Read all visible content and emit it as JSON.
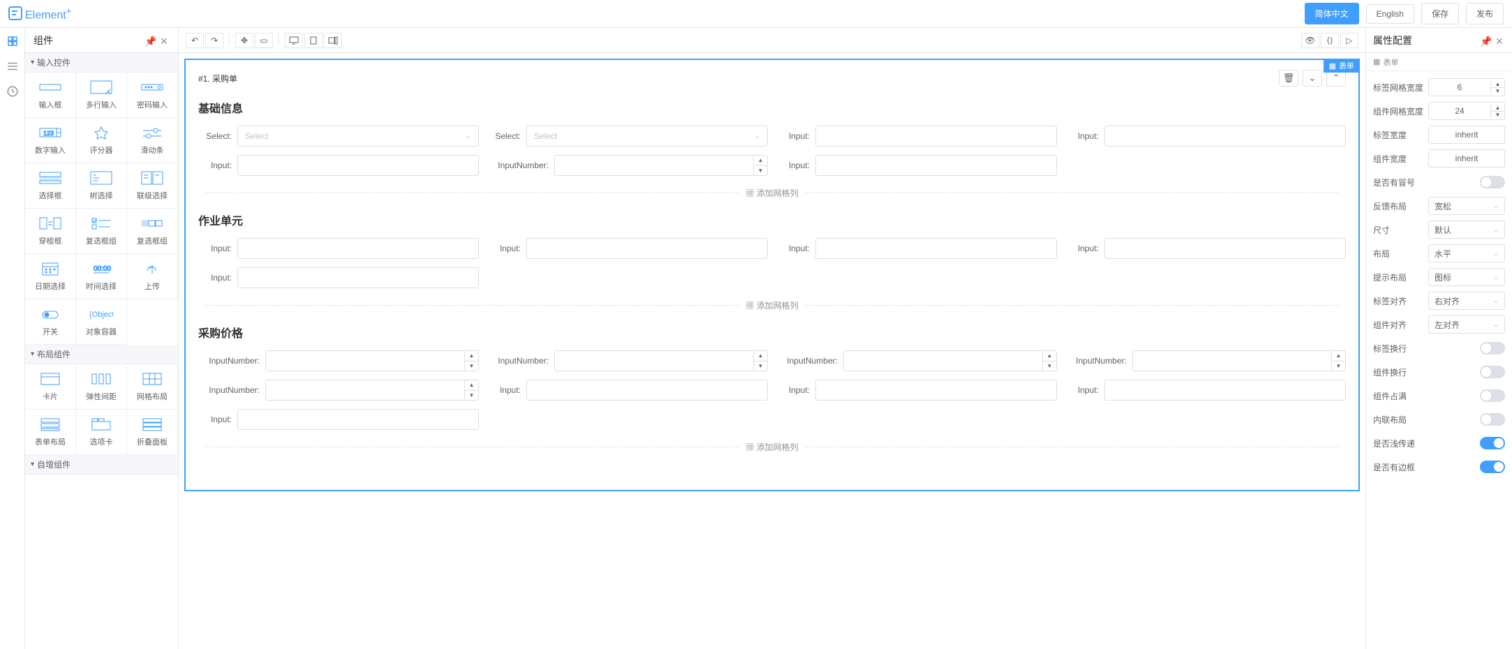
{
  "logo": {
    "text": "Element",
    "sup": "+"
  },
  "topbar": {
    "langZh": "简体中文",
    "langEn": "English",
    "save": "保存",
    "publish": "发布"
  },
  "sidebar": {
    "title": "组件",
    "groups": {
      "input": {
        "label": "输入控件",
        "items": [
          {
            "label": "输入框",
            "icon": "input"
          },
          {
            "label": "多行输入",
            "icon": "textarea"
          },
          {
            "label": "密码输入",
            "icon": "password"
          },
          {
            "label": "数字输入",
            "icon": "number"
          },
          {
            "label": "评分器",
            "icon": "rate"
          },
          {
            "label": "滑动条",
            "icon": "slider"
          },
          {
            "label": "选择框",
            "icon": "select"
          },
          {
            "label": "树选择",
            "icon": "treeselect"
          },
          {
            "label": "联级选择",
            "icon": "cascader"
          },
          {
            "label": "穿梭框",
            "icon": "transfer"
          },
          {
            "label": "复选框组",
            "icon": "checkbox"
          },
          {
            "label": "复选框组",
            "icon": "checkboxbtn"
          },
          {
            "label": "日期选择",
            "icon": "date"
          },
          {
            "label": "时间选择",
            "icon": "time"
          },
          {
            "label": "上传",
            "icon": "upload"
          },
          {
            "label": "开关",
            "icon": "switch"
          },
          {
            "label": "对象容器",
            "icon": "object"
          }
        ]
      },
      "layout": {
        "label": "布局组件",
        "items": [
          {
            "label": "卡片",
            "icon": "card"
          },
          {
            "label": "弹性间距",
            "icon": "space"
          },
          {
            "label": "网格布局",
            "icon": "grid"
          },
          {
            "label": "表单布局",
            "icon": "formlayout"
          },
          {
            "label": "选项卡",
            "icon": "tabs"
          },
          {
            "label": "折叠面板",
            "icon": "collapse"
          }
        ]
      },
      "self": {
        "label": "自增组件"
      }
    }
  },
  "canvas": {
    "formTag": "表单",
    "formTitle": "#1. 采购单",
    "section1": "基础信息",
    "section2": "作业单元",
    "section3": "采购价格",
    "labels": {
      "select": "Select:",
      "input": "Input:",
      "inputNumber": "InputNumber:"
    },
    "placeholder": {
      "select": "Select"
    },
    "addHint": "添加网格列"
  },
  "props": {
    "title": "属性配置",
    "subtitle": "表单",
    "fields": {
      "labelGridWidth": {
        "label": "标签网格宽度",
        "value": "6"
      },
      "compGridWidth": {
        "label": "组件网格宽度",
        "value": "24"
      },
      "labelWidth": {
        "label": "标签宽度",
        "value": "inherit"
      },
      "compWidth": {
        "label": "组件宽度",
        "value": "inherit"
      },
      "hasColon": {
        "label": "是否有冒号"
      },
      "feedbackLayout": {
        "label": "反馈布局",
        "value": "宽松"
      },
      "size": {
        "label": "尺寸",
        "value": "默认"
      },
      "layout": {
        "label": "布局",
        "value": "水平"
      },
      "tooltipLayout": {
        "label": "提示布局",
        "value": "图标"
      },
      "labelAlign": {
        "label": "标签对齐",
        "value": "右对齐"
      },
      "compAlign": {
        "label": "组件对齐",
        "value": "左对齐"
      },
      "labelWrap": {
        "label": "标签换行"
      },
      "compWrap": {
        "label": "组件换行"
      },
      "fill": {
        "label": "组件占满"
      },
      "inline": {
        "label": "内联布局"
      },
      "shallow": {
        "label": "是否浅传递"
      },
      "border": {
        "label": "是否有边框"
      }
    }
  }
}
